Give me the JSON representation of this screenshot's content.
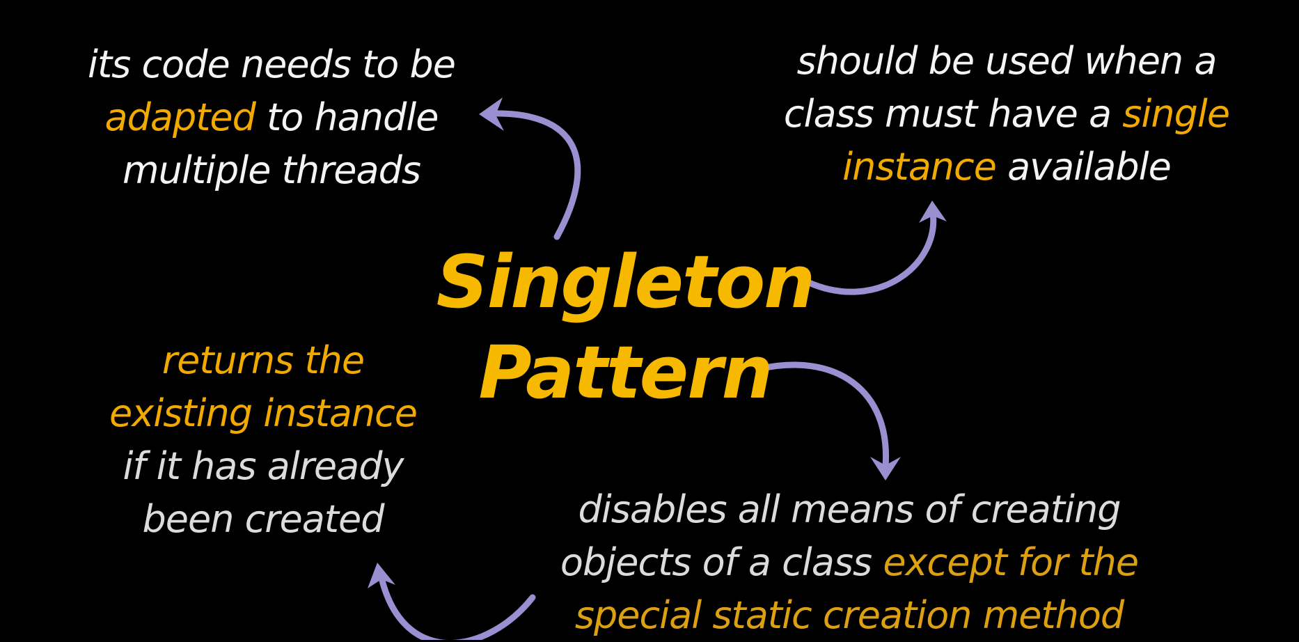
{
  "title": {
    "line1": "Singleton",
    "line2": "Pattern"
  },
  "top_left": {
    "line1": "its code needs to be",
    "line2_highlight": "adapted",
    "line2_rest": " to handle",
    "line3": "multiple threads"
  },
  "top_right": {
    "line1": "should be used when a",
    "line2_rest": "class must have a ",
    "line2_highlight": "single",
    "line3_highlight": "instance",
    "line3_rest": " available"
  },
  "bottom_left": {
    "line1_highlight": "returns the",
    "line2_highlight": "existing instance",
    "line3": "if it has already",
    "line4": "been created"
  },
  "bottom_right": {
    "line1": "disables all means of creating",
    "line2_rest": "objects of a class ",
    "line2_highlight": "except for the",
    "line3_highlight": "special static creation method"
  },
  "colors": {
    "background": "#000000",
    "title": "#f7b900",
    "highlight": "#f2a900",
    "arrow": "#9a8fd0",
    "text": "#f4f4f4"
  }
}
